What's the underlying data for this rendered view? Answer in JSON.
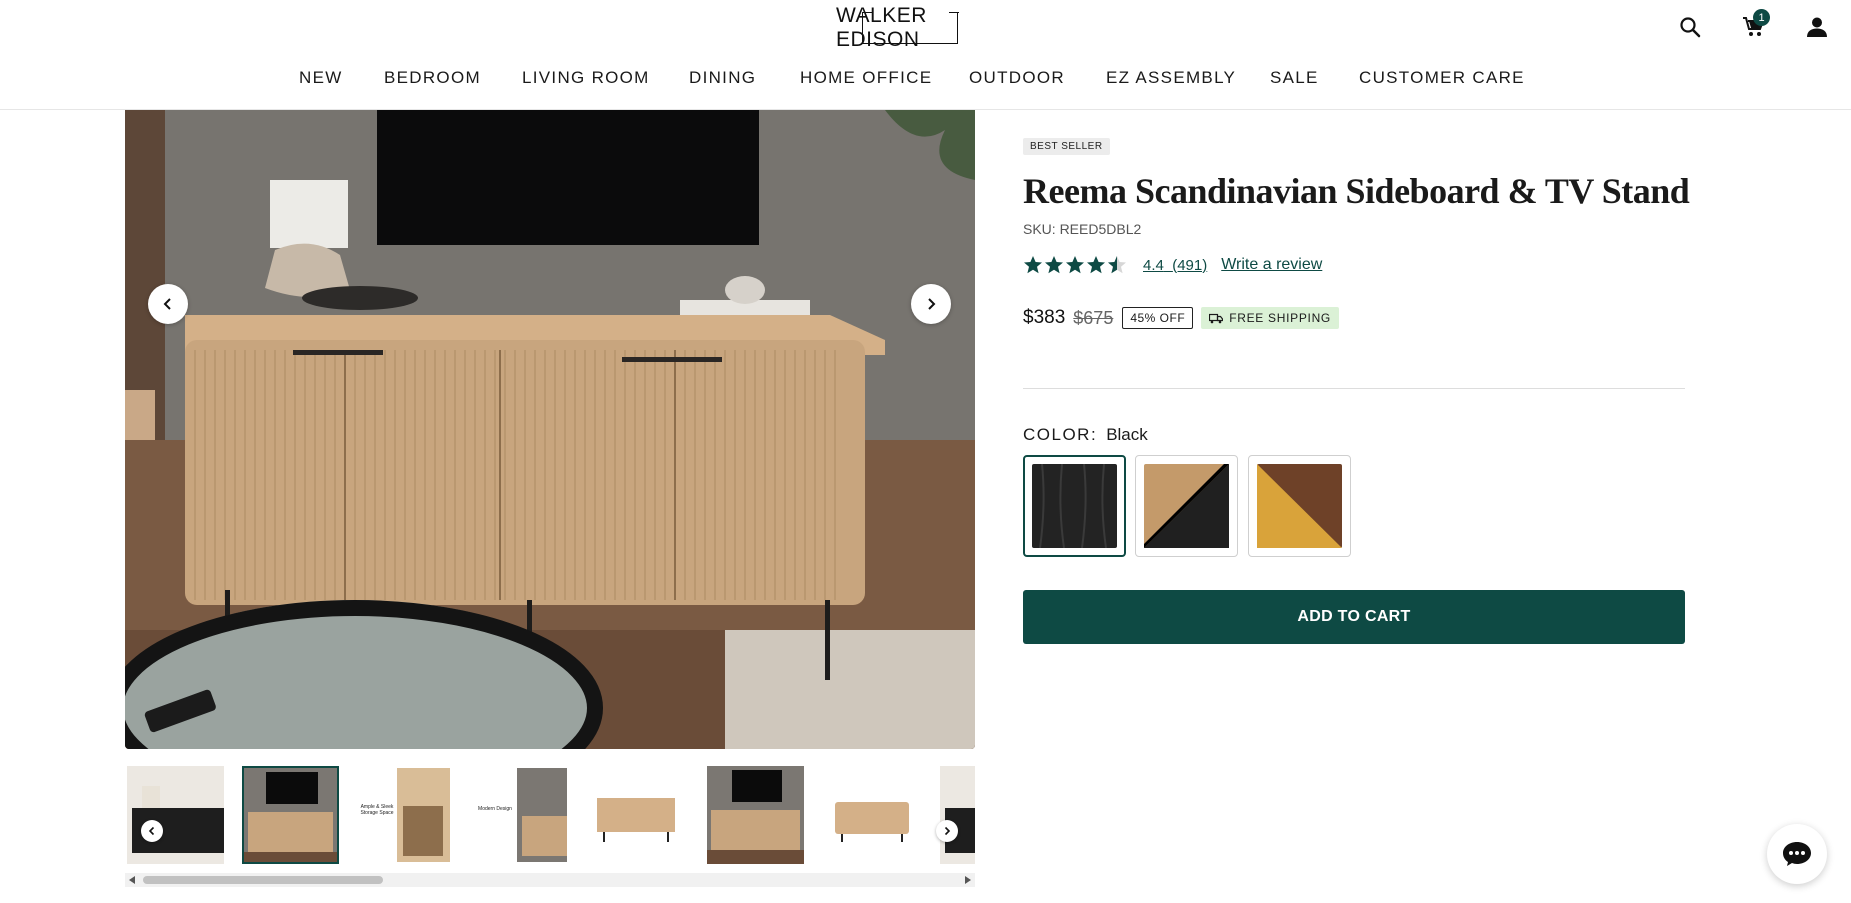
{
  "brand": {
    "logo_text": "WALKER EDISON"
  },
  "header": {
    "icons": [
      "search-icon",
      "cart-icon",
      "account-icon"
    ],
    "cart_count": "1"
  },
  "nav": {
    "items": [
      "NEW",
      "BEDROOM",
      "LIVING ROOM",
      "DINING",
      "HOME OFFICE",
      "OUTDOOR",
      "EZ ASSEMBLY",
      "SALE",
      "CUSTOMER CARE"
    ]
  },
  "gallery": {
    "main_image": "Sideboard TV stand in natural oak finish with TV above",
    "thumbnail_count": 8,
    "selected_thumbnail": 2,
    "thumb_captions": [
      "Ample & Sleek Storage Space",
      "Modern Design"
    ]
  },
  "product": {
    "badge": "BEST SELLER",
    "title": "Reema Scandinavian Sideboard & TV Stand",
    "sku": "SKU: REED5DBL2",
    "rating_value": "4.4",
    "rating_count": "(491)",
    "write_review": "Write a review",
    "price": "$383",
    "old_price": "$675",
    "discount": "45% OFF",
    "shipping": "FREE SHIPPING",
    "color_label": "COLOR:",
    "color_value": "Black",
    "swatches": [
      "Black",
      "Natural / Black",
      "Brown / Gold"
    ],
    "add_to_cart": "ADD TO CART"
  },
  "colors": {
    "accent": "#0e4a44",
    "ship_bg": "#dbf1d6"
  }
}
